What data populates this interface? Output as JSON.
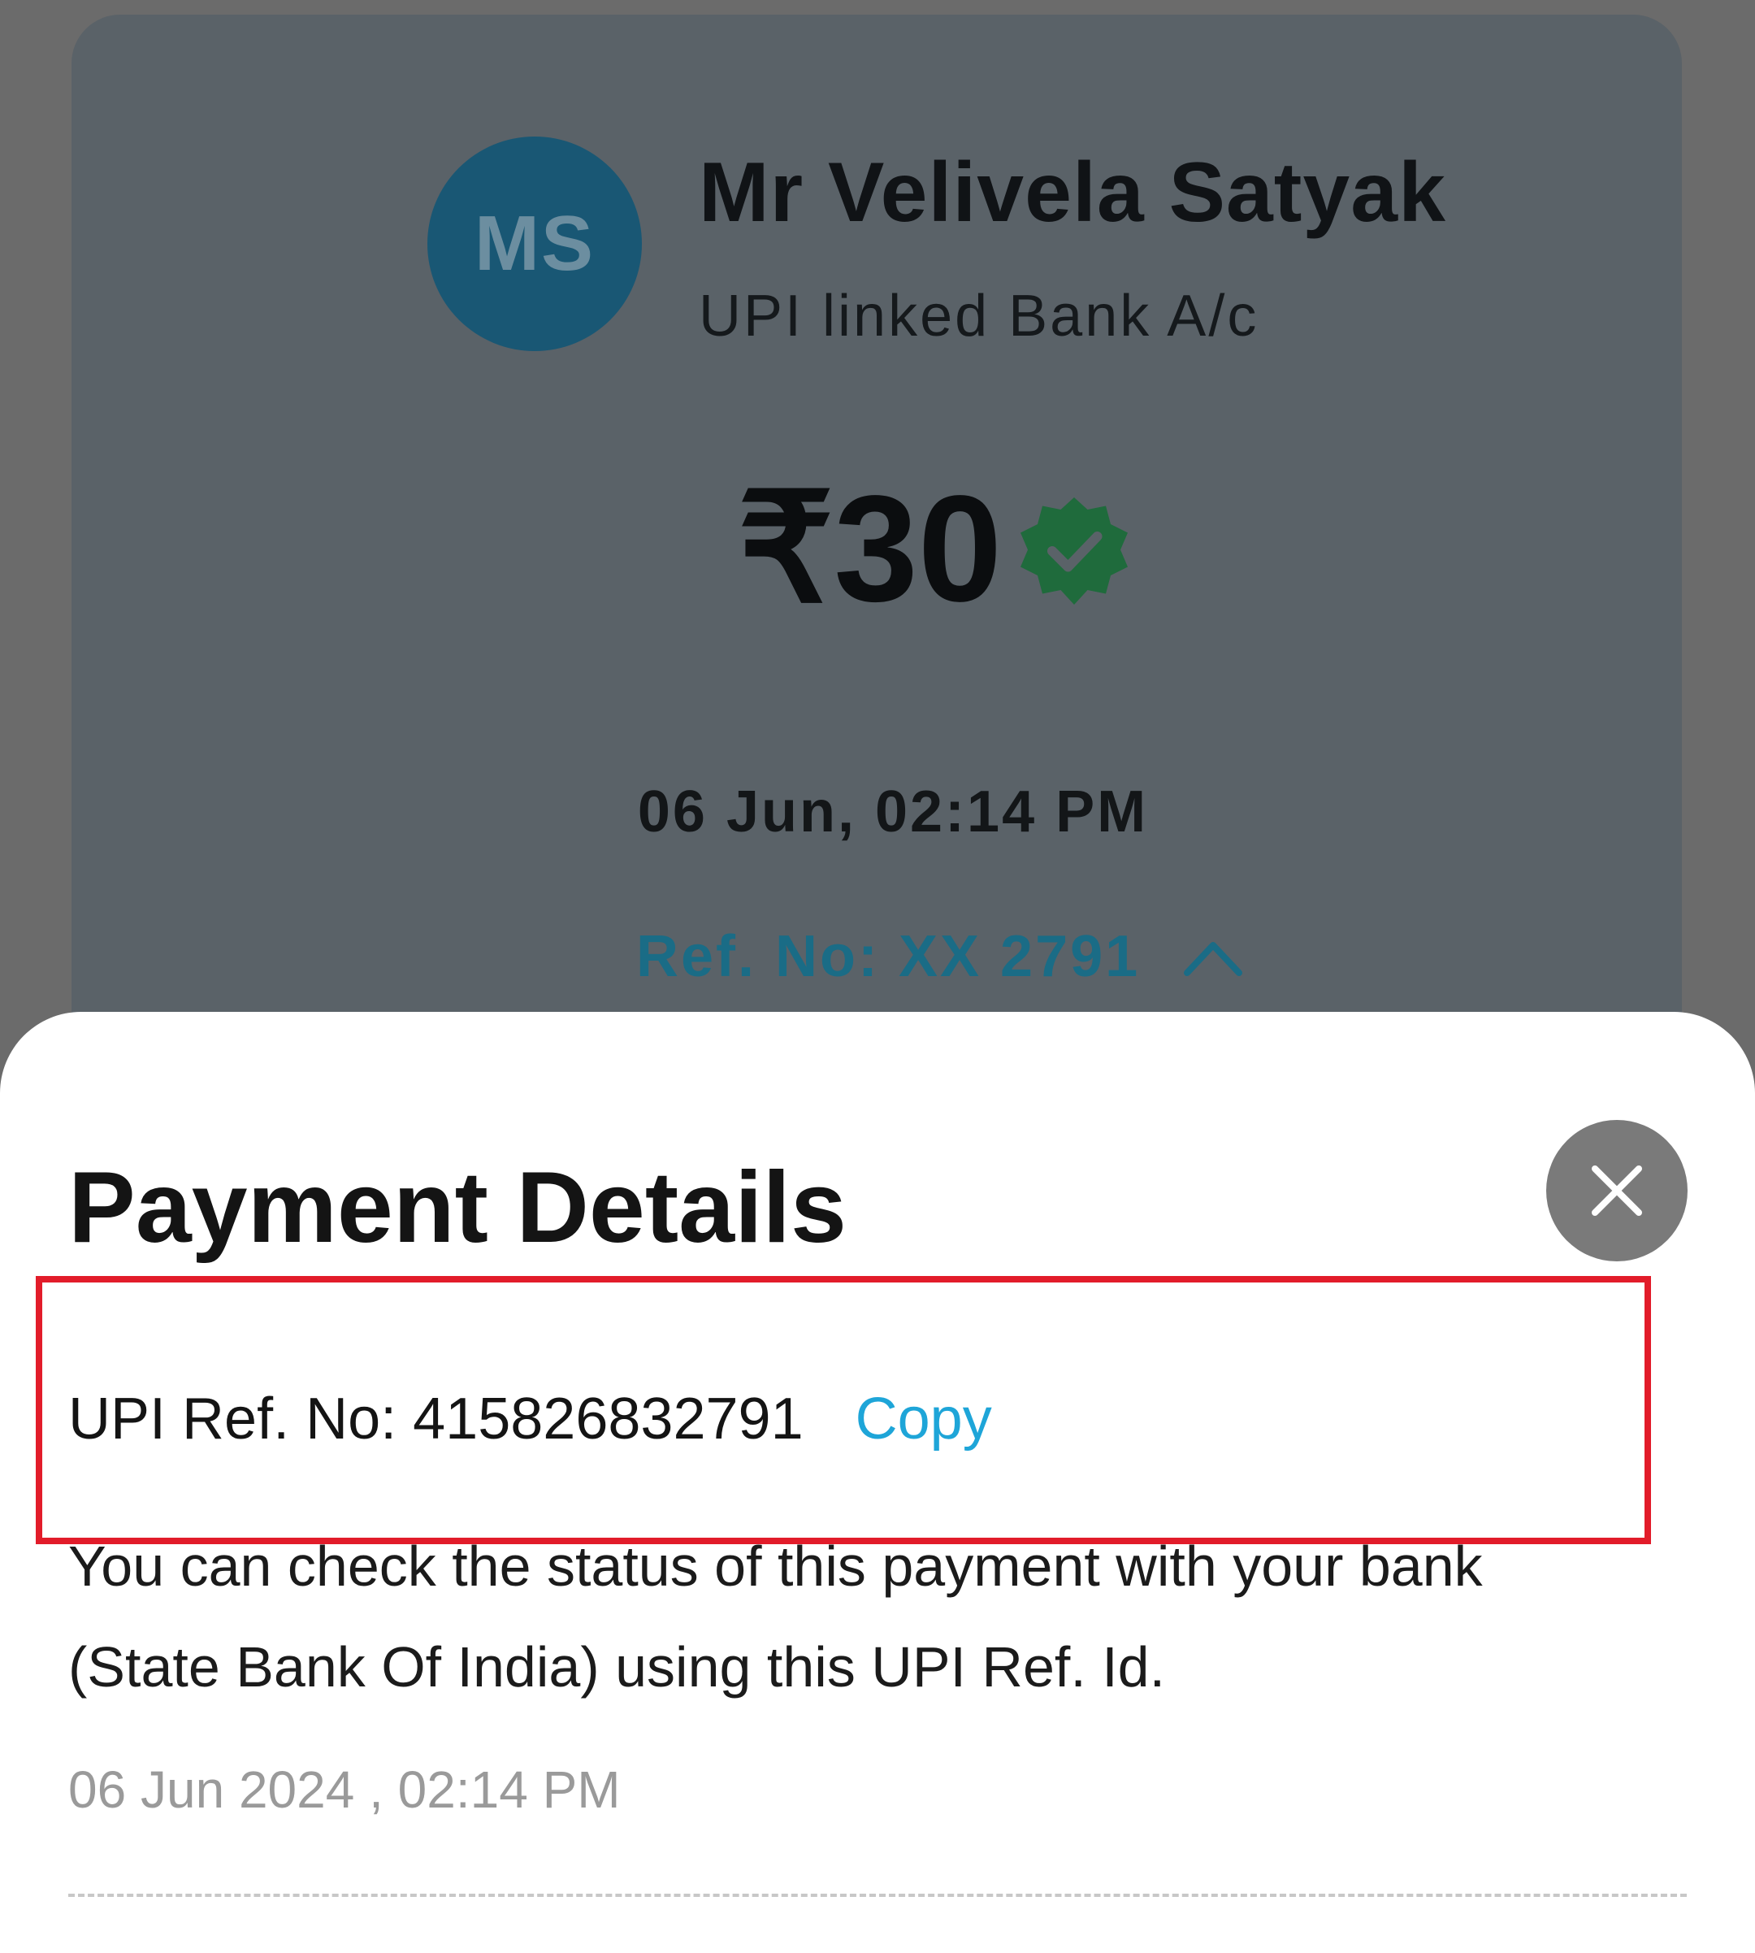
{
  "receipt": {
    "avatar_initials": "MS",
    "payee_name": "Mr Velivela Satyak",
    "payee_subtitle": "UPI linked Bank A/c",
    "amount": "₹30",
    "status_icon": "verified-check-badge",
    "datetime": "06 Jun, 02:14 PM",
    "ref_label": "Ref. No: XX 2791"
  },
  "details_sheet": {
    "title": "Payment Details",
    "upi_ref_label": "UPI Ref. No:",
    "upi_ref_value": "415826832791",
    "copy_label": "Copy",
    "status_note": "You can check the status of this payment with your bank (State Bank Of India) using this UPI Ref. Id.",
    "datetime": "06 Jun 2024 , 02:14 PM"
  },
  "colors": {
    "avatar_bg": "#195774",
    "ref_link": "#1a6c86",
    "copy_link": "#1ea5d8",
    "verified_badge": "#1f6b3c",
    "highlight_box": "#e21c2a"
  }
}
